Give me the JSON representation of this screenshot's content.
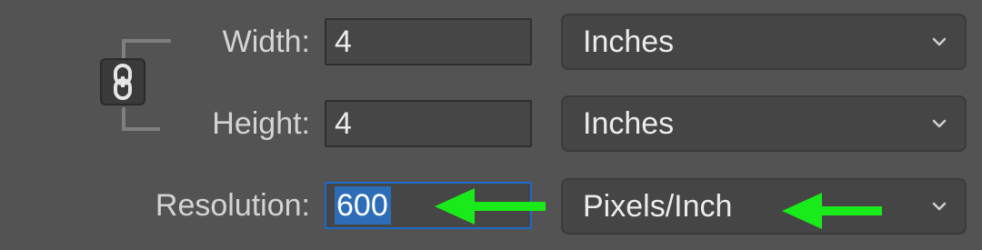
{
  "width": {
    "label": "Width:",
    "value": "4",
    "unit": "Inches"
  },
  "height": {
    "label": "Height:",
    "value": "4",
    "unit": "Inches"
  },
  "resolution": {
    "label": "Resolution:",
    "value": "600",
    "unit": "Pixels/Inch"
  },
  "icons": {
    "constrain": "chain-link-icon",
    "dropdown": "chevron-down-icon",
    "annotation": "left-arrow-icon"
  },
  "colors": {
    "background": "#535353",
    "label": "#d4d4d4",
    "focus_border": "#1b6ac9",
    "selection": "#2d6db7",
    "annotation_arrow": "#19ea19"
  }
}
